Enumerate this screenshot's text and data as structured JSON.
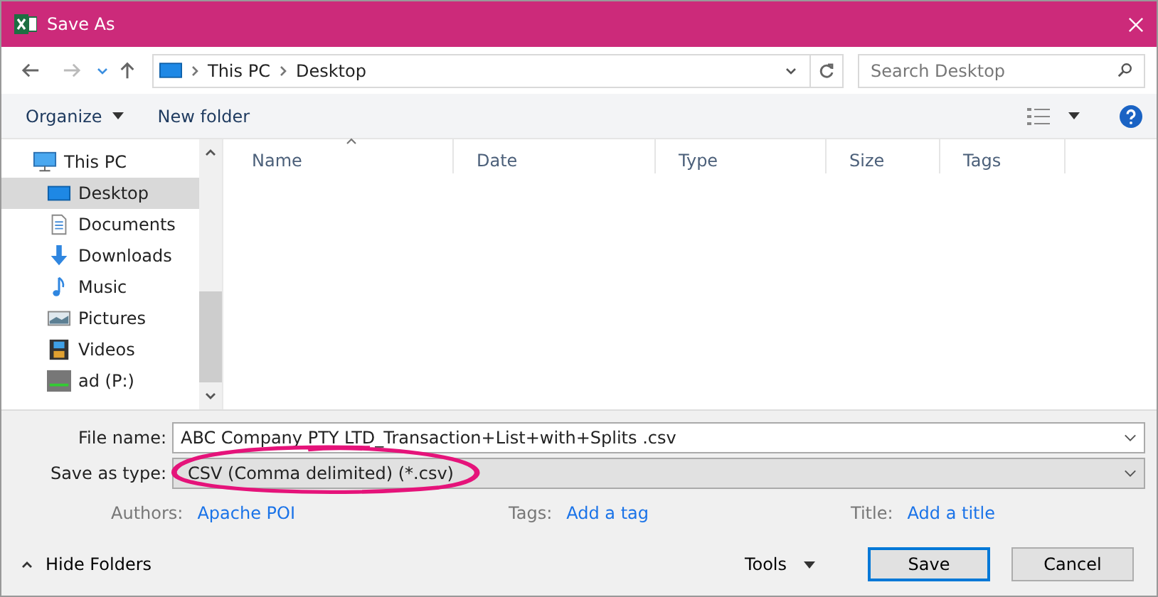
{
  "window": {
    "title": "Save As"
  },
  "address": {
    "path": [
      {
        "label": "This PC"
      },
      {
        "label": "Desktop"
      }
    ]
  },
  "search": {
    "placeholder": "Search Desktop"
  },
  "toolbar": {
    "organize": "Organize",
    "new_folder": "New folder"
  },
  "sidebar": {
    "items": [
      {
        "label": "This PC",
        "kind": "pc",
        "selected": false,
        "children": [
          {
            "label": "Desktop",
            "kind": "desktop",
            "selected": true
          },
          {
            "label": "Documents",
            "kind": "documents",
            "selected": false
          },
          {
            "label": "Downloads",
            "kind": "downloads",
            "selected": false
          },
          {
            "label": "Music",
            "kind": "music",
            "selected": false
          },
          {
            "label": "Pictures",
            "kind": "pictures",
            "selected": false
          },
          {
            "label": "Videos",
            "kind": "videos",
            "selected": false
          },
          {
            "label": "ad (P:)",
            "kind": "drive",
            "selected": false
          }
        ]
      }
    ]
  },
  "table": {
    "columns": [
      "Name",
      "Date",
      "Type",
      "Size",
      "Tags"
    ]
  },
  "form": {
    "file_name": {
      "label": "File name:",
      "value": "ABC Company PTY LTD_Transaction+List+with+Splits .csv"
    },
    "save_as_type": {
      "label": "Save as type:",
      "value": "CSV (Comma delimited) (*.csv)"
    },
    "meta": [
      {
        "label": "Authors:",
        "value": "Apache POI"
      },
      {
        "label": "Tags:",
        "value": "Add a tag"
      },
      {
        "label": "Title:",
        "value": "Add a title"
      }
    ]
  },
  "footer": {
    "hide_folders": "Hide Folders",
    "tools": "Tools",
    "buttons": [
      "Save",
      "Cancel"
    ]
  }
}
